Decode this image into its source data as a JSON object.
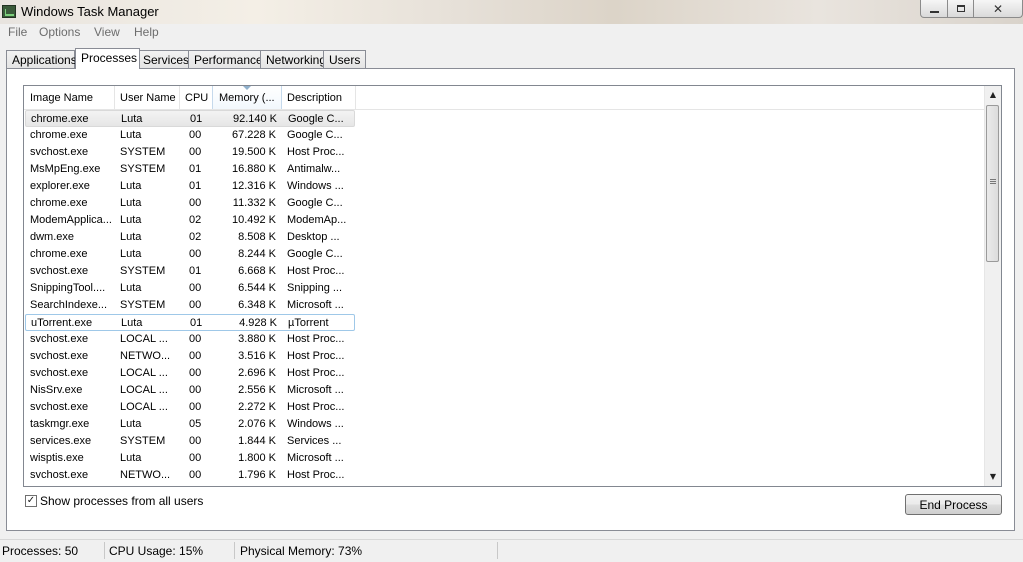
{
  "window": {
    "title": "Windows Task Manager",
    "minimize": "minimize-icon",
    "maximize": "maximize-icon",
    "close": "✕"
  },
  "menu": [
    "File",
    "Options",
    "View",
    "Help"
  ],
  "tabs": [
    "Applications",
    "Processes",
    "Services",
    "Performance",
    "Networking",
    "Users"
  ],
  "active_tab": "Processes",
  "columns": [
    "Image Name",
    "User Name",
    "CPU",
    "Memory (...",
    "Description"
  ],
  "sorted_column": "Memory (...",
  "rows": [
    {
      "name": "chrome.exe",
      "user": "Luta",
      "cpu": "01",
      "mem": "92.140 K",
      "desc": "Google C..."
    },
    {
      "name": "chrome.exe",
      "user": "Luta",
      "cpu": "00",
      "mem": "67.228 K",
      "desc": "Google C..."
    },
    {
      "name": "svchost.exe",
      "user": "SYSTEM",
      "cpu": "00",
      "mem": "19.500 K",
      "desc": "Host Proc..."
    },
    {
      "name": "MsMpEng.exe",
      "user": "SYSTEM",
      "cpu": "01",
      "mem": "16.880 K",
      "desc": "Antimalw..."
    },
    {
      "name": "explorer.exe",
      "user": "Luta",
      "cpu": "01",
      "mem": "12.316 K",
      "desc": "Windows ..."
    },
    {
      "name": "chrome.exe",
      "user": "Luta",
      "cpu": "00",
      "mem": "11.332 K",
      "desc": "Google C..."
    },
    {
      "name": "ModemApplica...",
      "user": "Luta",
      "cpu": "02",
      "mem": "10.492 K",
      "desc": "ModemAp..."
    },
    {
      "name": "dwm.exe",
      "user": "Luta",
      "cpu": "02",
      "mem": "8.508 K",
      "desc": "Desktop ..."
    },
    {
      "name": "chrome.exe",
      "user": "Luta",
      "cpu": "00",
      "mem": "8.244 K",
      "desc": "Google C..."
    },
    {
      "name": "svchost.exe",
      "user": "SYSTEM",
      "cpu": "01",
      "mem": "6.668 K",
      "desc": "Host Proc..."
    },
    {
      "name": "SnippingTool....",
      "user": "Luta",
      "cpu": "00",
      "mem": "6.544 K",
      "desc": "Snipping ..."
    },
    {
      "name": "SearchIndexe...",
      "user": "SYSTEM",
      "cpu": "00",
      "mem": "6.348 K",
      "desc": "Microsoft ..."
    },
    {
      "name": "uTorrent.exe",
      "user": "Luta",
      "cpu": "01",
      "mem": "4.928 K",
      "desc": "µTorrent"
    },
    {
      "name": "svchost.exe",
      "user": "LOCAL ...",
      "cpu": "00",
      "mem": "3.880 K",
      "desc": "Host Proc..."
    },
    {
      "name": "svchost.exe",
      "user": "NETWO...",
      "cpu": "00",
      "mem": "3.516 K",
      "desc": "Host Proc..."
    },
    {
      "name": "svchost.exe",
      "user": "LOCAL ...",
      "cpu": "00",
      "mem": "2.696 K",
      "desc": "Host Proc..."
    },
    {
      "name": "NisSrv.exe",
      "user": "LOCAL ...",
      "cpu": "00",
      "mem": "2.556 K",
      "desc": "Microsoft ..."
    },
    {
      "name": "svchost.exe",
      "user": "LOCAL ...",
      "cpu": "00",
      "mem": "2.272 K",
      "desc": "Host Proc..."
    },
    {
      "name": "taskmgr.exe",
      "user": "Luta",
      "cpu": "05",
      "mem": "2.076 K",
      "desc": "Windows ..."
    },
    {
      "name": "services.exe",
      "user": "SYSTEM",
      "cpu": "00",
      "mem": "1.844 K",
      "desc": "Services ..."
    },
    {
      "name": "wisptis.exe",
      "user": "Luta",
      "cpu": "00",
      "mem": "1.800 K",
      "desc": "Microsoft ..."
    },
    {
      "name": "svchost.exe",
      "user": "NETWO...",
      "cpu": "00",
      "mem": "1.796 K",
      "desc": "Host Proc..."
    }
  ],
  "selected_row": 0,
  "focused_row": 12,
  "show_all_users": {
    "label": "Show processes from all users",
    "checked": true,
    "check_glyph": "✓"
  },
  "end_process_label": "End Process",
  "status": {
    "processes": "Processes: 50",
    "cpu": "CPU Usage: 15%",
    "memory": "Physical Memory: 73%"
  }
}
